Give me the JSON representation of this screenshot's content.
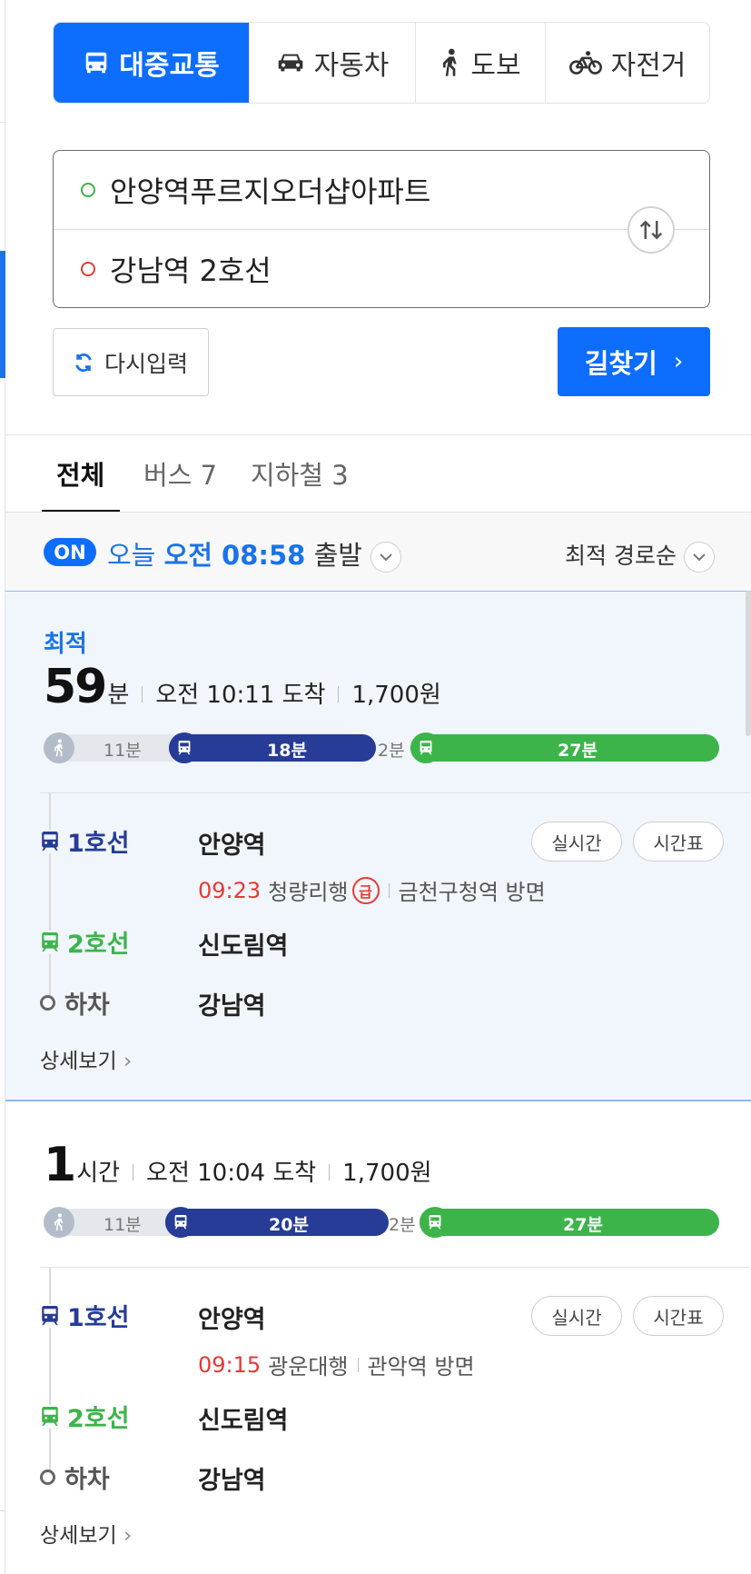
{
  "modes": [
    {
      "label": "대중교통",
      "icon": "bus-icon",
      "active": true
    },
    {
      "label": "자동차",
      "icon": "car-icon",
      "active": false
    },
    {
      "label": "도보",
      "icon": "walk-icon",
      "active": false
    },
    {
      "label": "자전거",
      "icon": "bike-icon",
      "active": false
    }
  ],
  "route": {
    "origin": "안양역푸르지오더샵아파트",
    "destination": "강남역 2호선"
  },
  "buttons": {
    "reset": "다시입력",
    "search": "길찾기"
  },
  "tabs": [
    {
      "label": "전체",
      "active": true
    },
    {
      "label": "버스 7",
      "active": false
    },
    {
      "label": "지하철 3",
      "active": false
    }
  ],
  "departure": {
    "on": "ON",
    "day": "오늘",
    "time": "오전 08:58",
    "suffix": "출발",
    "sort": "최적 경로순"
  },
  "colors": {
    "accent": "#0d6efd",
    "line1": "#263c96",
    "line2": "#3cb44a",
    "realtime": "#e53935"
  },
  "results": [
    {
      "badge": "최적",
      "duration_num": "59",
      "duration_unit": "분",
      "arrival": "오전 10:11 도착",
      "fare": "1,700원",
      "bar": {
        "walk": "11분",
        "line1": "18분",
        "transfer": "2분",
        "line2": "27분"
      },
      "steps": {
        "line1": "1호선",
        "board": "안양역",
        "realtime": "실시간",
        "timetable": "시간표",
        "train_time": "09:23",
        "train_dest": "청량리행",
        "express": "급",
        "direction": "금천구청역 방면",
        "line2": "2호선",
        "transfer_station": "신도림역",
        "alight_label": "하차",
        "alight_station": "강남역"
      },
      "detail": "상세보기"
    },
    {
      "badge": "",
      "duration_num": "1",
      "duration_unit": "시간",
      "arrival": "오전 10:04 도착",
      "fare": "1,700원",
      "bar": {
        "walk": "11분",
        "line1": "20분",
        "transfer": "2분",
        "line2": "27분"
      },
      "steps": {
        "line1": "1호선",
        "board": "안양역",
        "realtime": "실시간",
        "timetable": "시간표",
        "train_time": "09:15",
        "train_dest": "광운대행",
        "direction": "관악역 방면",
        "line2": "2호선",
        "transfer_station": "신도림역",
        "alight_label": "하차",
        "alight_station": "강남역"
      },
      "detail": "상세보기"
    }
  ]
}
